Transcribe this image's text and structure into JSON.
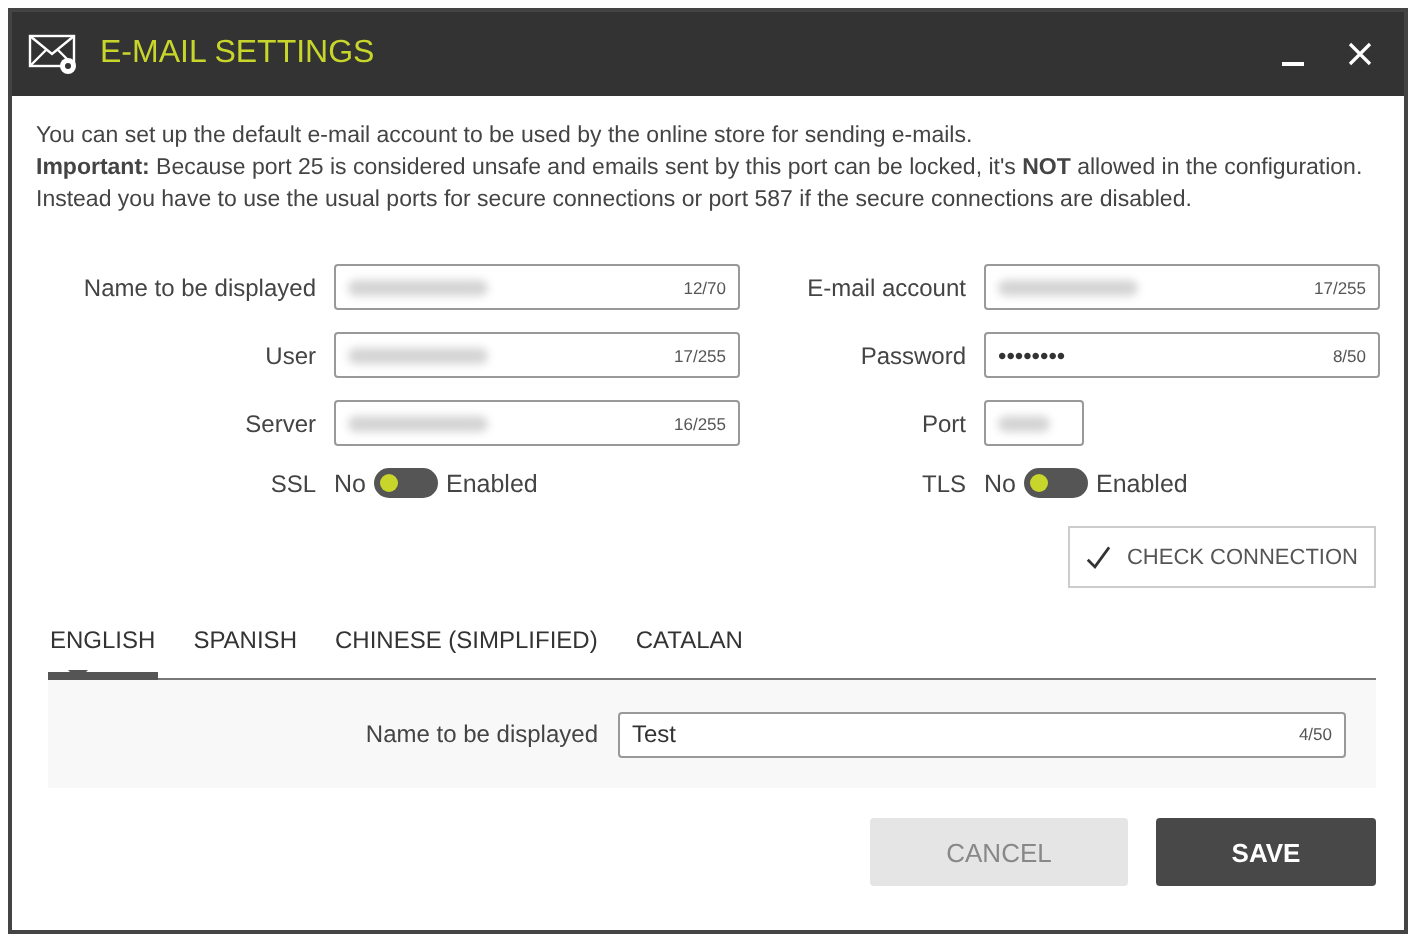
{
  "window": {
    "title": "E-MAIL SETTINGS"
  },
  "intro": [
    "You can set up the default e-mail account to be used by the online store for sending e-mails.",
    "**Important:** Because port 25 is considered unsafe and emails sent by this port can be locked, it's **NOT** allowed in the configuration.",
    "Instead you have to use the usual ports for secure connections or port 587 if the secure connections are disabled."
  ],
  "fields": [
    {
      "label": "Name to be displayed",
      "blurred": true,
      "counter": "12/70"
    },
    {
      "label": "E-mail account",
      "blurred": true,
      "counter": "17/255"
    },
    {
      "label": "User",
      "blurred": true,
      "counter": "17/255"
    },
    {
      "label": "Password",
      "value": "••••••••",
      "counter": "8/50"
    },
    {
      "label": "Server",
      "blurred": true,
      "counter": "16/255"
    },
    {
      "label": "Port",
      "blurred": true
    }
  ],
  "toggles": [
    {
      "label": "SSL",
      "off_text": "No",
      "on_text": "Enabled",
      "on": false
    },
    {
      "label": "TLS",
      "off_text": "No",
      "on_text": "Enabled",
      "on": false
    }
  ],
  "check_button": "CHECK CONNECTION",
  "tabs": [
    {
      "label": "ENGLISH",
      "selected": true
    },
    {
      "label": "SPANISH",
      "selected": false
    },
    {
      "label": "CHINESE (SIMPLIFIED)",
      "selected": false
    },
    {
      "label": "CATALAN",
      "selected": false
    }
  ],
  "tab_field": {
    "label": "Name to be displayed",
    "value": "Test",
    "counter": "4/50"
  },
  "buttons": [
    {
      "label": "CANCEL",
      "kind": "secondary"
    },
    {
      "label": "SAVE",
      "kind": "primary"
    }
  ]
}
